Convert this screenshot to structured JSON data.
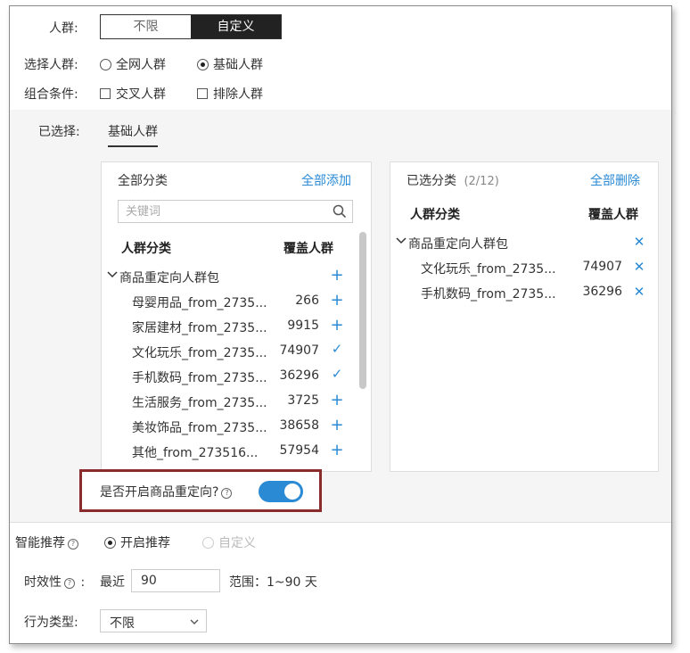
{
  "crowd": {
    "label": "人群:",
    "tabs": [
      "不限",
      "自定义"
    ],
    "active_tab": "自定义"
  },
  "select_crowd": {
    "label": "选择人群:",
    "options": [
      "全网人群",
      "基础人群"
    ],
    "selected": "基础人群"
  },
  "combine": {
    "label": "组合条件:",
    "options": [
      "交叉人群",
      "排除人群"
    ]
  },
  "selected": {
    "label": "已选择:",
    "tab": "基础人群"
  },
  "left_panel": {
    "title": "全部分类",
    "add_all": "全部添加",
    "search_placeholder": "关键词",
    "col_category": "人群分类",
    "col_coverage": "覆盖人群",
    "group": "商品重定向人群包",
    "rows": [
      {
        "name": "母婴用品_from_2735...",
        "value": "266",
        "action": "+"
      },
      {
        "name": "家居建材_from_2735...",
        "value": "9915",
        "action": "+"
      },
      {
        "name": "文化玩乐_from_2735...",
        "value": "74907",
        "action": "✓"
      },
      {
        "name": "手机数码_from_2735...",
        "value": "36296",
        "action": "✓"
      },
      {
        "name": "生活服务_from_2735...",
        "value": "3725",
        "action": "+"
      },
      {
        "name": "美妆饰品_from_2735...",
        "value": "38658",
        "action": "+"
      },
      {
        "name": "其他_from_273516...",
        "value": "57954",
        "action": "+"
      }
    ]
  },
  "right_panel": {
    "title": "已选分类",
    "count": "(2/12)",
    "delete_all": "全部删除",
    "col_category": "人群分类",
    "col_coverage": "覆盖人群",
    "group": "商品重定向人群包",
    "rows": [
      {
        "name": "文化玩乐_from_2735...",
        "value": "74907"
      },
      {
        "name": "手机数码_from_2735...",
        "value": "36296"
      }
    ]
  },
  "redirect": {
    "label": "是否开启商品重定向?",
    "enabled": true
  },
  "smart": {
    "label": "智能推荐",
    "options": [
      "开启推荐",
      "自定义"
    ],
    "selected": "开启推荐"
  },
  "timeliness": {
    "label": "时效性",
    "prefix": "最近",
    "value": "90",
    "range": "范围：1~90 天"
  },
  "behavior": {
    "label": "行为类型:",
    "value": "不限"
  },
  "colors": {
    "accent": "#2a8ad4",
    "highlight_border": "#8b2c2c",
    "dark_tab": "#222222"
  }
}
